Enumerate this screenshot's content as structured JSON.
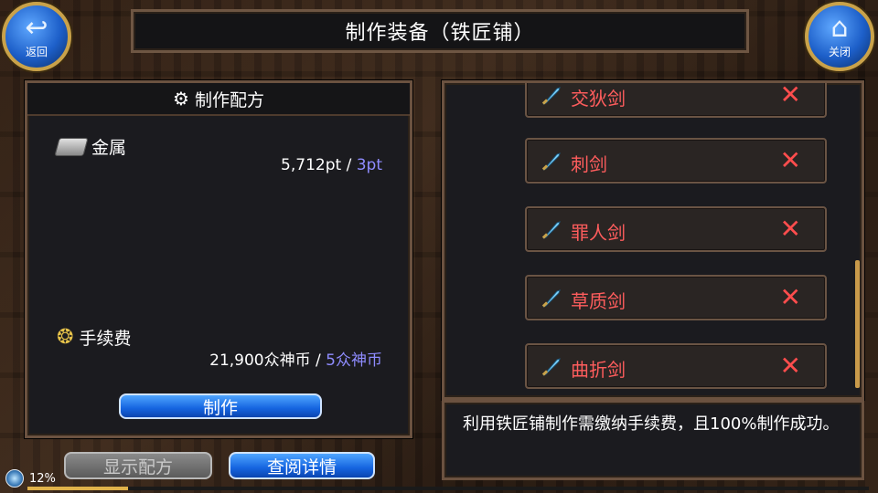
{
  "header": {
    "title": "制作装备（铁匠铺）",
    "back_label": "返回",
    "close_label": "关闭"
  },
  "recipe": {
    "title": "制作配方",
    "metal": {
      "label": "金属",
      "have": "5,712pt",
      "separator": "/",
      "need": "3pt"
    },
    "fee": {
      "label": "手续费",
      "have": "21,900众神币",
      "separator": "/",
      "need": "5众神币"
    },
    "craft_button": "制作",
    "show_recipe_button": "显示配方",
    "details_button": "查阅详情"
  },
  "items": [
    {
      "name": "交狄剑",
      "icon": "sword-icon"
    },
    {
      "name": "刺剑",
      "icon": "sword-icon"
    },
    {
      "name": "罪人剑",
      "icon": "sword-icon"
    },
    {
      "name": "草质剑",
      "icon": "sword-icon"
    },
    {
      "name": "曲折剑",
      "icon": "sword-icon"
    }
  ],
  "description": "利用铁匠铺制作需缴纳手续费，且100%制作成功。",
  "status": {
    "percent_text": "12%",
    "progress": 0.12
  },
  "colors": {
    "item_name": "#ff5d5d",
    "need_value": "#8f8cff",
    "frame": "#6b5240",
    "button_blue": "#1564e0"
  }
}
